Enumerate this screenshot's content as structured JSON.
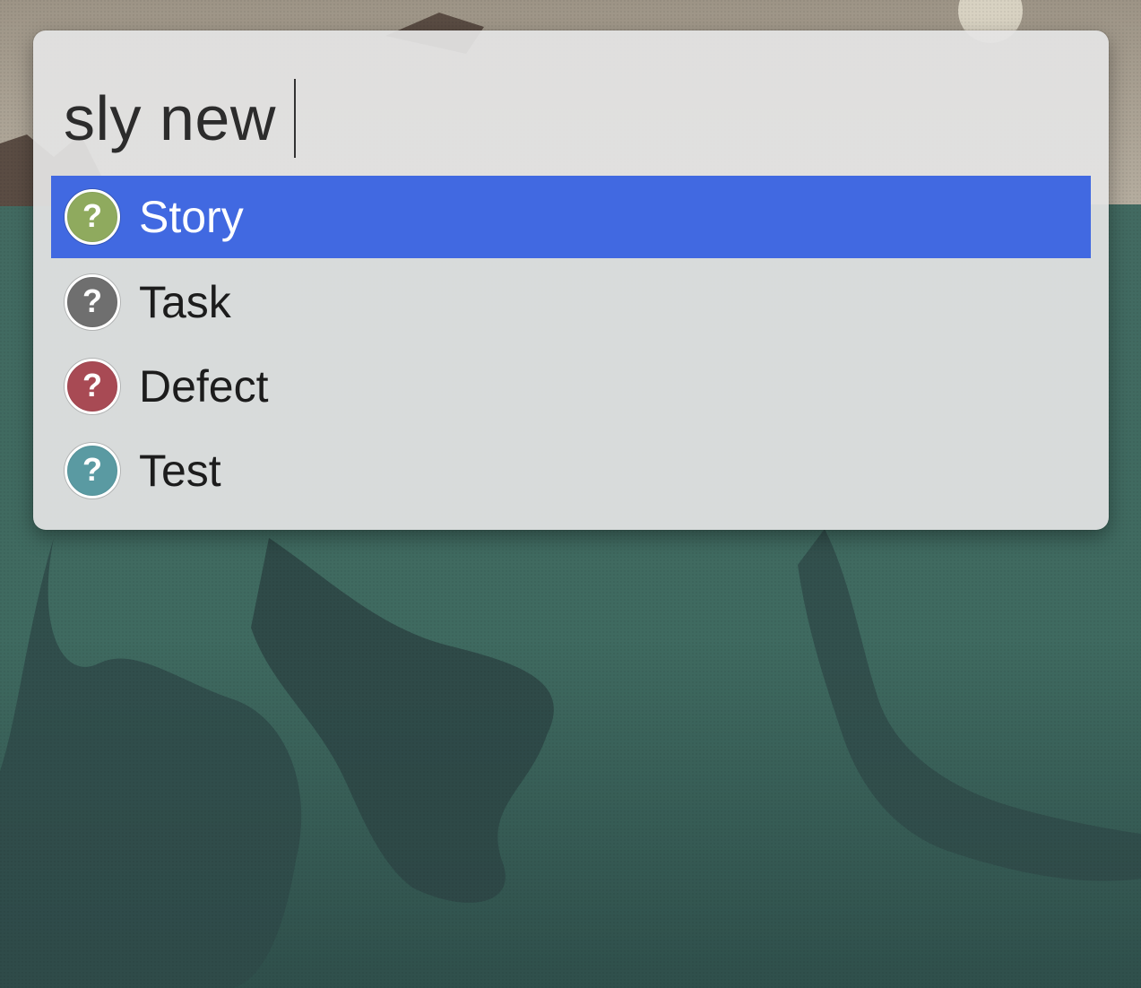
{
  "launcher": {
    "query": "sly new",
    "selection_color": "#4169E1",
    "results": [
      {
        "label": "Story",
        "icon": "question-icon",
        "icon_color": "#8FAA5E",
        "selected": true
      },
      {
        "label": "Task",
        "icon": "question-icon",
        "icon_color": "#6F6F6F",
        "selected": false
      },
      {
        "label": "Defect",
        "icon": "question-icon",
        "icon_color": "#A84A54",
        "selected": false
      },
      {
        "label": "Test",
        "icon": "question-icon",
        "icon_color": "#5A9AA2",
        "selected": false
      }
    ],
    "icon_glyph": "?"
  }
}
